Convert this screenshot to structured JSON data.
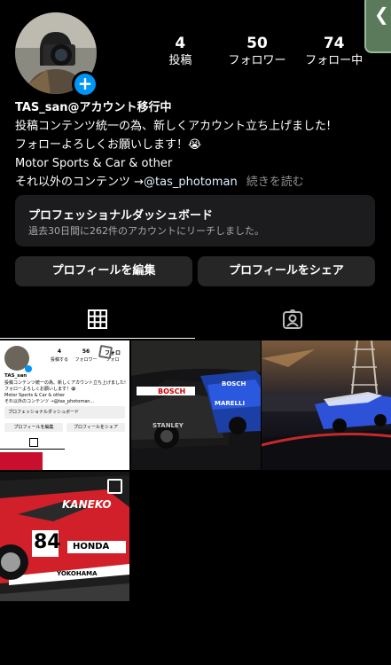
{
  "profile": {
    "username": "TAS_san@アカウント移行中",
    "bio_lines": [
      "投稿コンテンツ統一の為、新しくアカウント立ち上げました!",
      "フォローよろしくお願いします！😭",
      "Motor Sports & Car & other"
    ],
    "bio_last_prefix": "それ以外のコンテンツ →",
    "bio_link": "@tas_photoman",
    "more_label": "続きを読む"
  },
  "stats": [
    {
      "value": "4",
      "label": "投稿"
    },
    {
      "value": "50",
      "label": "フォロワー"
    },
    {
      "value": "74",
      "label": "フォロー中"
    }
  ],
  "dashboard": {
    "title": "プロフェッショナルダッシュボード",
    "subtitle": "過去30日間に262件のアカウントにリーチしました。"
  },
  "buttons": {
    "edit": "プロフィールを編集",
    "share": "プロフィールをシェア"
  },
  "side_tab_glyph": "❮",
  "posts": {
    "post1": {
      "user": "TAS_san",
      "stats": [
        "4",
        "56",
        "フォロ"
      ],
      "stat_labels": [
        "投稿する",
        "フォロワー",
        "フォロ"
      ],
      "bio1": "投稿コンテンツ統一の為、新しくアカウント立ち上げました!",
      "bio2": "フォローよろしくお願いします！😭",
      "bio3": "Motor Sports & Car & other",
      "bio4": "それ以外のコンテンツ →@tas_photoman...",
      "dash": "プロフェッショナルダッシュボード",
      "edit": "プロフィールを編集",
      "share": "プロフィールをシェア"
    },
    "post2": {
      "logo1": "BOSCH",
      "logo2": "BOSCH",
      "logo3": "MARELLI",
      "logo4": "STANLEY"
    },
    "post4": {
      "brand": "KANEKO",
      "number": "84",
      "honda": "HONDA",
      "yoko": "YOKOHAMA"
    }
  }
}
